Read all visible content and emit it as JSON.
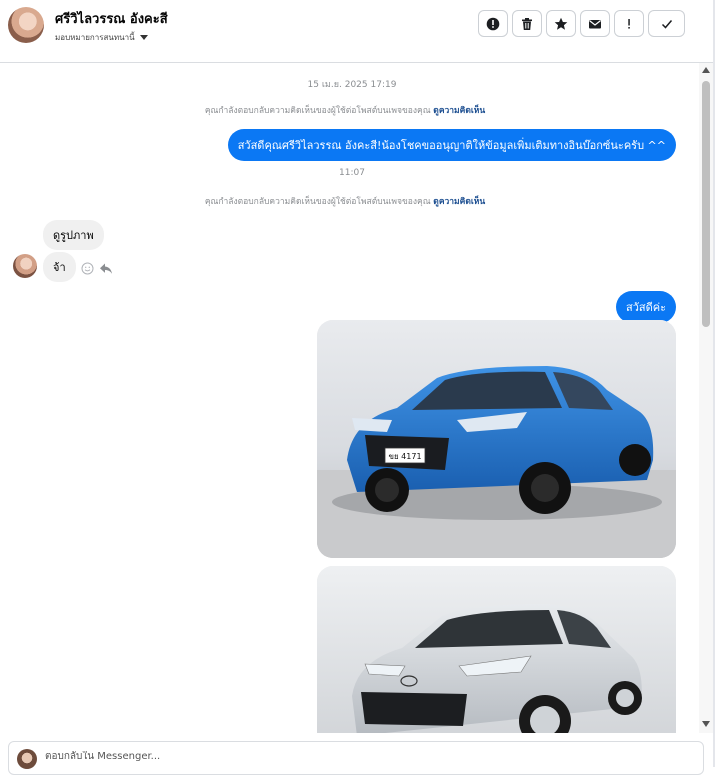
{
  "header": {
    "contact_name": "ศรีวิไลวรรณ อังคะสี",
    "assign_label": "มอบหมายการสนทนานี้",
    "toolbar": [
      {
        "name": "report-button",
        "icon": "alert-circle-icon"
      },
      {
        "name": "delete-button",
        "icon": "trash-icon"
      },
      {
        "name": "star-button",
        "icon": "star-icon"
      },
      {
        "name": "mark-unread-button",
        "icon": "envelope-icon"
      },
      {
        "name": "flag-button",
        "icon": "exclamation-icon"
      },
      {
        "name": "done-button",
        "icon": "check-icon"
      }
    ]
  },
  "thread": {
    "timestamp_1": "15 เม.ย. 2025 17:19",
    "notice_text": "คุณกำลังตอบกลับความคิดเห็นของผู้ใช้ต่อโพสต์บนเพจของคุณ",
    "notice_link": "ดูความคิดเห็น",
    "outgoing_1": "สวัสดีคุณศรีวิไลวรรณ อังคะสี!น้องโชคขออนุญาติให้ข้อมูลเพิ่มเติมทางอินบ๊อกซ์นะครับ ^^",
    "timestamp_2": "11:07",
    "incoming_1": "ดูรูปภาพ",
    "incoming_2": "จ้า",
    "outgoing_2": "สวัสดีค่ะ",
    "photo_1_plate": "ขย 4171"
  },
  "composer": {
    "placeholder": "ตอบกลับใน Messenger..."
  },
  "colors": {
    "accent": "#0b78f4",
    "link": "#1d4f91",
    "bubble_in": "#f0f0f0"
  }
}
